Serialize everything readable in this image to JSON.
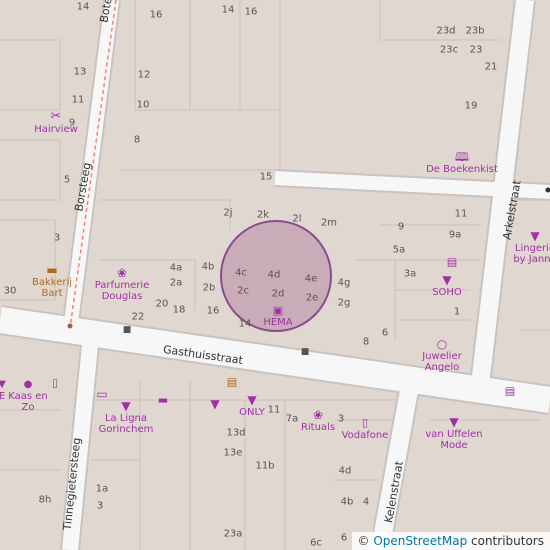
{
  "map": {
    "streets": [
      {
        "name": "Gasthuisstraat"
      },
      {
        "name": "Borsteeg"
      },
      {
        "name": "Bote"
      },
      {
        "name": "Tinnegietersteeg"
      },
      {
        "name": "Kelenstraat"
      },
      {
        "name": "Arkelstraat"
      }
    ],
    "pois": [
      {
        "label": "Hairview",
        "icon": "hair-salon-icon"
      },
      {
        "label": "Bakkerij Bart",
        "icon": "bakery-icon"
      },
      {
        "label": "Parfumerie Douglas",
        "icon": "perfume-icon"
      },
      {
        "label": "HEMA",
        "icon": "department-store-icon"
      },
      {
        "label": "De Boekenkist",
        "icon": "book-icon"
      },
      {
        "label": "SOHO",
        "icon": "clothes-icon"
      },
      {
        "label": "Juwelier Angelo",
        "icon": "jewelry-icon"
      },
      {
        "label": "Lingerie by Janne",
        "icon": "clothes-icon"
      },
      {
        "label": "Kaas en Zo",
        "icon": "cheese-icon"
      },
      {
        "label": "E",
        "icon": "clothes-icon"
      },
      {
        "label": "La Ligna Gorinchem",
        "icon": "clothes-icon"
      },
      {
        "label": "ONLY",
        "icon": "clothes-icon"
      },
      {
        "label": "Rituals",
        "icon": "perfume-icon"
      },
      {
        "label": "Vodafone",
        "icon": "phone-icon"
      },
      {
        "label": "van Uffelen Mode",
        "icon": "clothes-icon"
      }
    ],
    "house_numbers": [
      "14",
      "16",
      "16",
      "14",
      "12",
      "13",
      "11",
      "10",
      "9",
      "8",
      "5",
      "3",
      "30",
      "22",
      "20",
      "18",
      "16",
      "14",
      "2j",
      "2k",
      "2l",
      "2m",
      "4a",
      "4b",
      "4c",
      "4d",
      "4e",
      "2a",
      "2b",
      "2c",
      "2d",
      "2e",
      "4g",
      "2g",
      "8",
      "6",
      "11",
      "9a",
      "9",
      "5a",
      "3a",
      "1",
      "15",
      "19",
      "23d",
      "23b",
      "23c",
      "23",
      "21",
      "11",
      "7a",
      "3",
      "13d",
      "13e",
      "11b",
      "4d",
      "4b",
      "4",
      "1a",
      "3",
      "8h",
      "23a",
      "6c",
      "6"
    ],
    "attribution": {
      "prefix": "©",
      "link": "OpenStreetMap",
      "suffix": "contributors"
    }
  }
}
